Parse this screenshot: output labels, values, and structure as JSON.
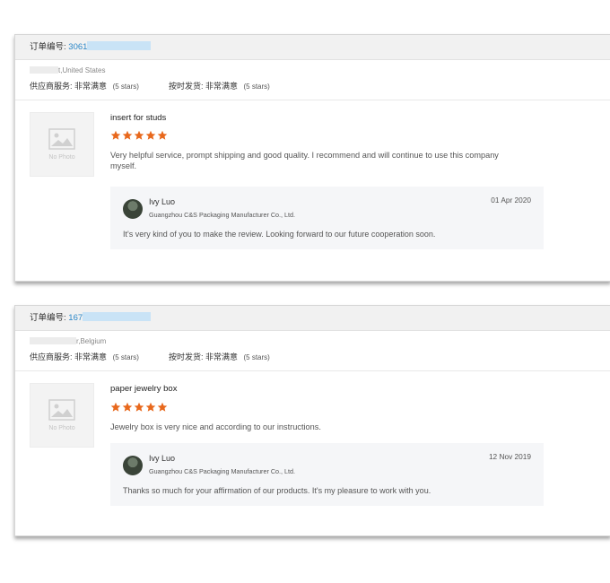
{
  "reviews": [
    {
      "order_label": "订单编号:",
      "order_number": "3061",
      "buyer_country": "t,United States",
      "supplier_service_label": "供应商服务:",
      "supplier_service_value": "非常满意",
      "supplier_service_stars": "(5 stars)",
      "ontime_label": "按时发货:",
      "ontime_value": "非常满意",
      "ontime_stars": "(5 stars)",
      "no_photo": "No Photo",
      "product_title": "insert for studs",
      "rating": 5,
      "review_text": "Very helpful service, prompt shipping and good quality. I recommend and will continue to use this company myself.",
      "reply": {
        "name": "Ivy Luo",
        "company": "Guangzhou C&S Packaging Manufacturer Co., Ltd.",
        "date": "01 Apr 2020",
        "text": "It's very kind of you to make the review. Looking forward to our future cooperation soon."
      }
    },
    {
      "order_label": "订单编号:",
      "order_number": "167",
      "buyer_country": "r,Belgium",
      "supplier_service_label": "供应商服务:",
      "supplier_service_value": "非常满意",
      "supplier_service_stars": "(5 stars)",
      "ontime_label": "按时发货:",
      "ontime_value": "非常满意",
      "ontime_stars": "(5 stars)",
      "no_photo": "No Photo",
      "product_title": "paper jewelry box",
      "rating": 5,
      "review_text": "Jewelry box is very nice and according to our instructions.",
      "reply": {
        "name": "Ivy Luo",
        "company": "Guangzhou C&S Packaging Manufacturer Co., Ltd.",
        "date": "12 Nov 2019",
        "text": "Thanks so much for your affirmation of our products. It's my pleasure to work with you."
      }
    }
  ],
  "colors": {
    "star": "#e8681c",
    "order_link": "#2a87c8",
    "header_bg": "#f1f1f1",
    "reply_bg": "#f5f6f8"
  }
}
